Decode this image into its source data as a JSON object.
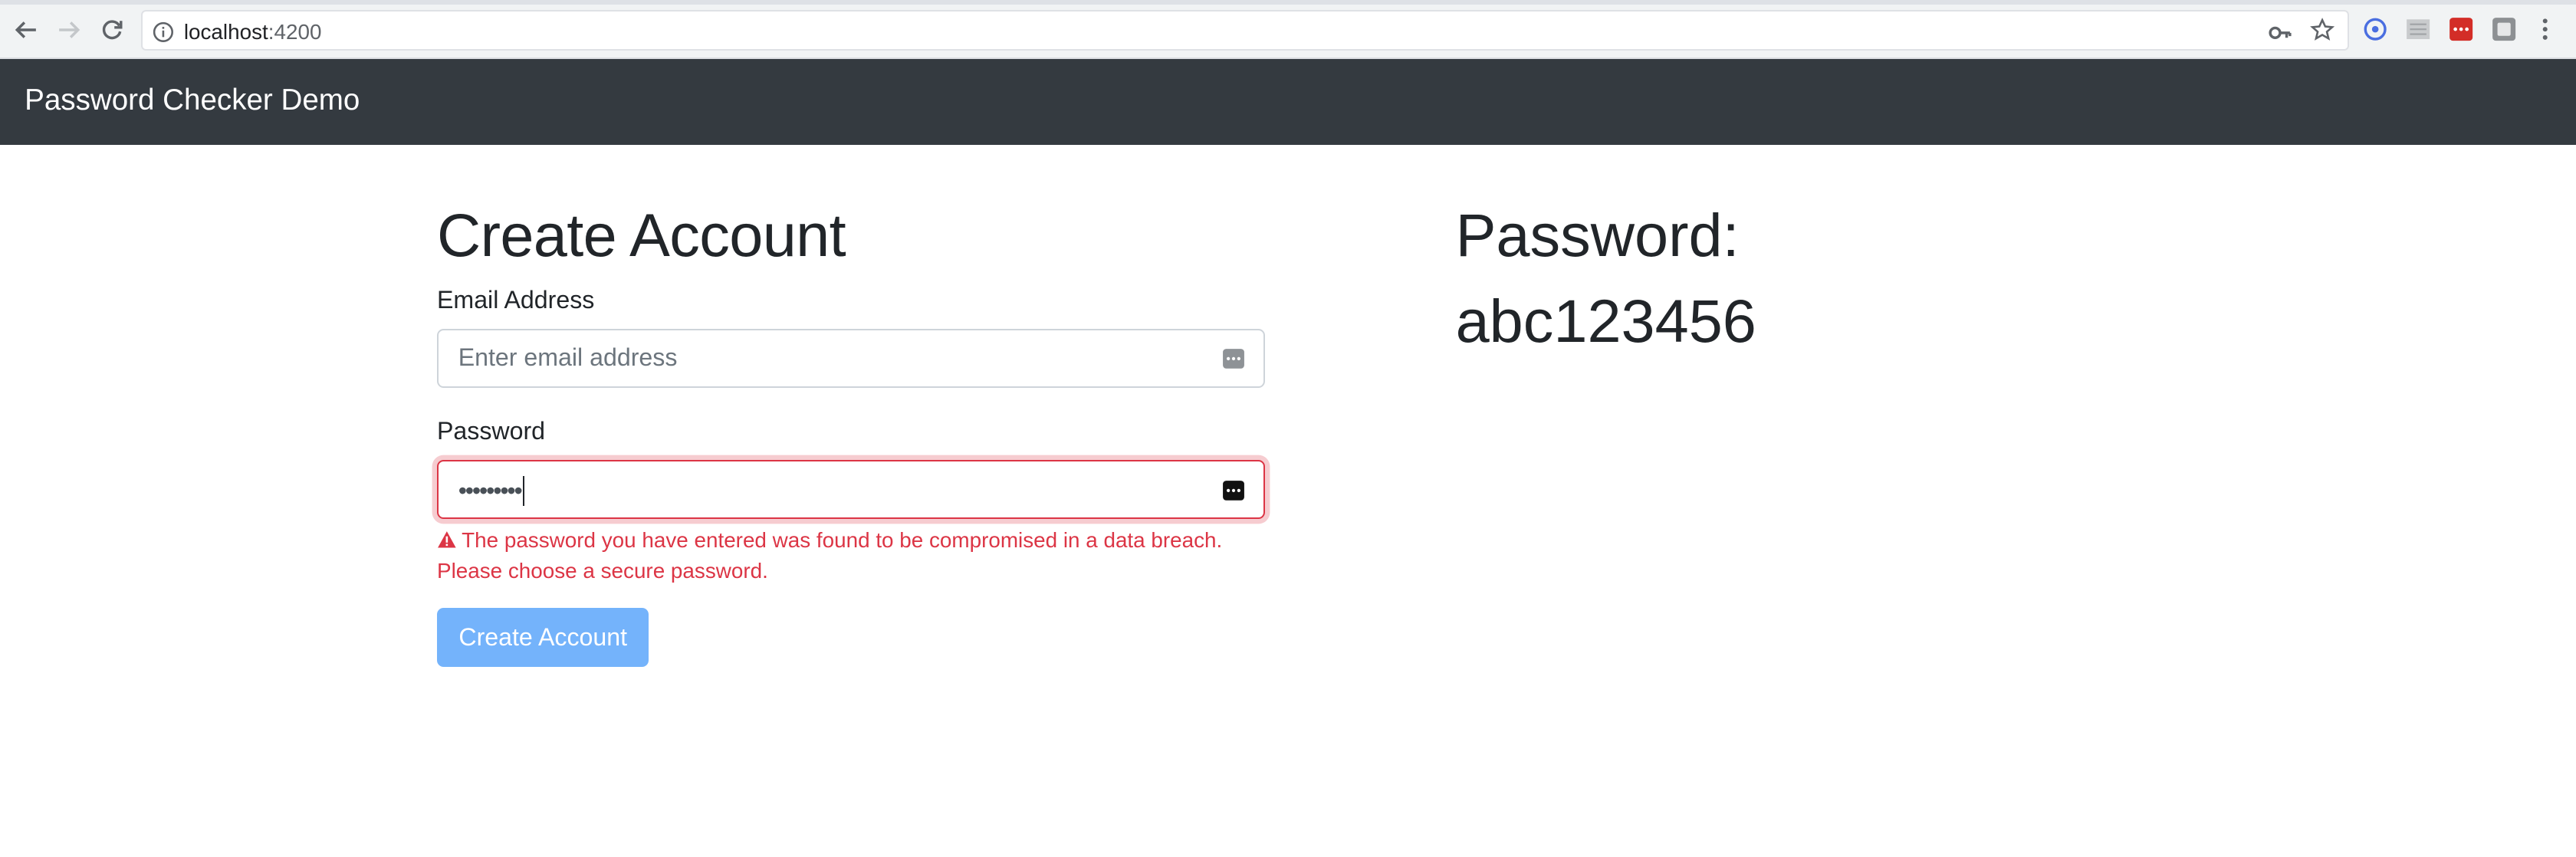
{
  "browser": {
    "url_host": "localhost",
    "url_port": ":4200"
  },
  "navbar": {
    "brand": "Password Checker Demo"
  },
  "form": {
    "title": "Create Account",
    "email_label": "Email Address",
    "email_placeholder": "Enter email address",
    "password_label": "Password",
    "password_masked": "•••••••••",
    "error_message": "The password you have entered was found to be compromised in a data breach. Please choose a secure password.",
    "submit_label": "Create Account"
  },
  "preview": {
    "heading": "Password:",
    "value": "abc123456"
  },
  "colors": {
    "navbar": "#343a40",
    "error": "#dc3545",
    "button": "#74b3fb"
  },
  "icons": [
    "back-arrow-icon",
    "forward-arrow-icon",
    "reload-icon",
    "info-icon",
    "key-icon",
    "star-icon",
    "password-manager-icon",
    "warning-icon",
    "menu-dots-icon"
  ]
}
